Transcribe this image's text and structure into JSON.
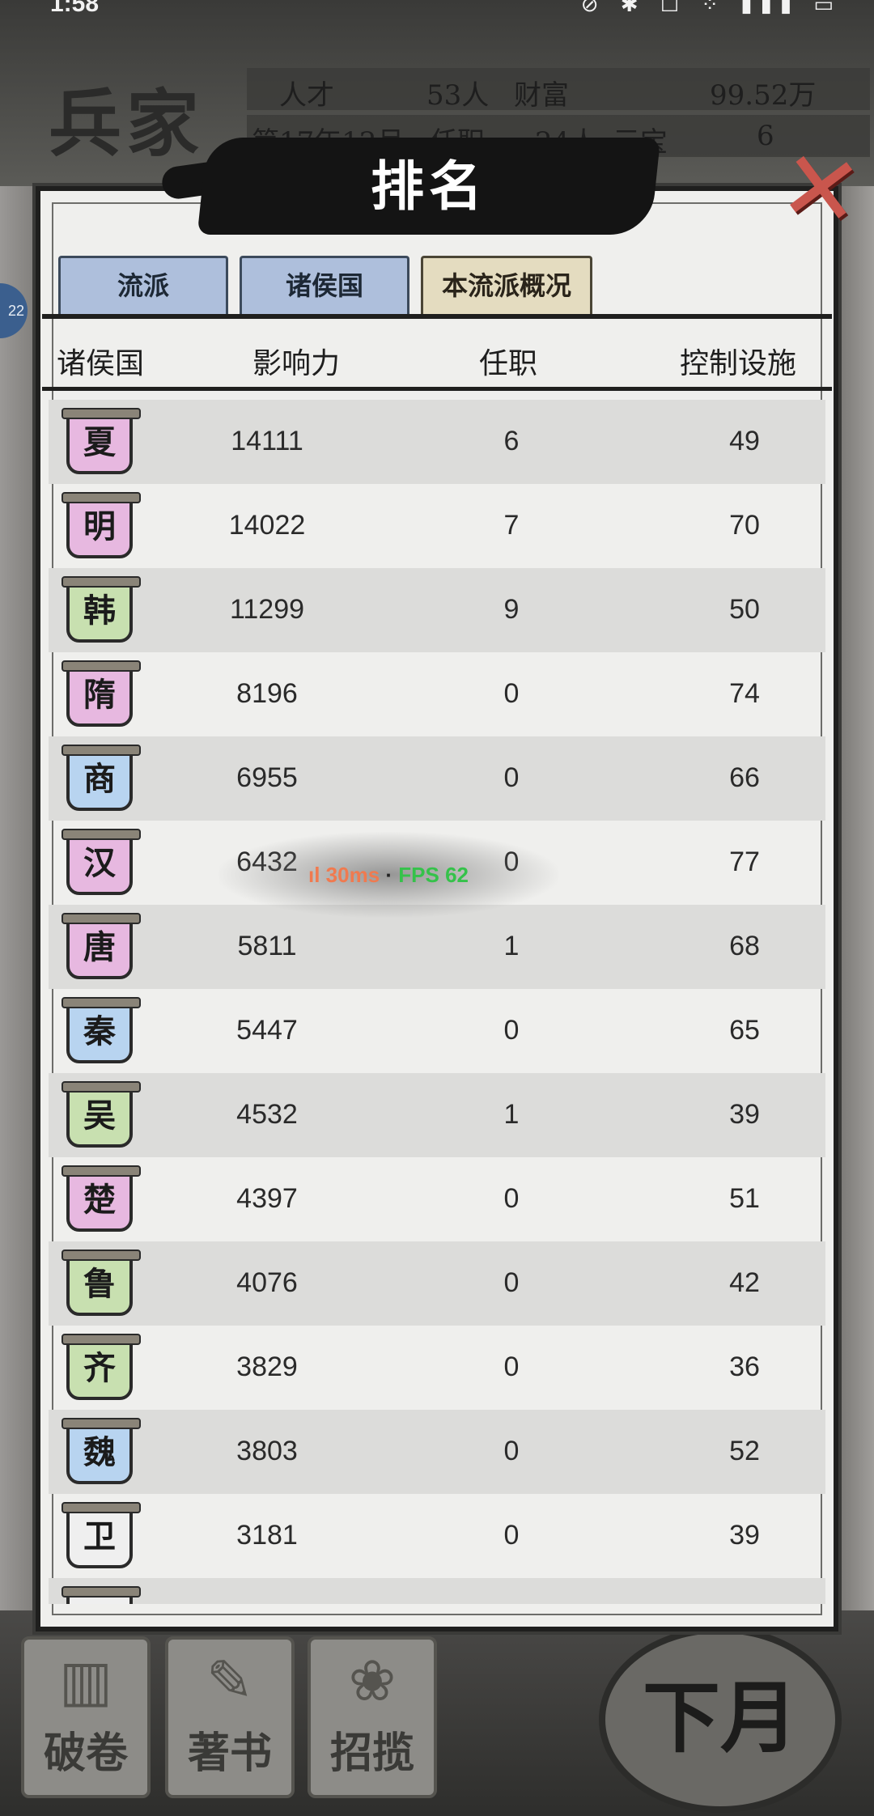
{
  "status_bar": {
    "time": "1:58",
    "icons": "⊘ ✱ ☐ ⁘ ▮▮▮ ▭"
  },
  "background": {
    "school_name": "兵家",
    "stats_row1": {
      "talent_label": "人才",
      "talent_value": "53人",
      "wealth_label": "财富",
      "wealth_value": "99.52万"
    },
    "stats_row2": {
      "date": "第17年12月",
      "office_label": "任职",
      "office_value": "24人",
      "ingot_label": "元宝",
      "ingot_value": "6"
    },
    "side_badge": "22",
    "bottom_buttons": [
      "破卷",
      "著书",
      "招揽"
    ],
    "next_month": "下月"
  },
  "dialog": {
    "title": "排名",
    "close_icon": "close-icon",
    "tabs": [
      {
        "label": "流派",
        "active": false
      },
      {
        "label": "诸侯国",
        "active": false
      },
      {
        "label": "本流派概况",
        "active": true
      }
    ],
    "columns": {
      "state": "诸侯国",
      "influence": "影响力",
      "office": "任职",
      "facilities": "控制设施"
    },
    "rows": [
      {
        "state": "夏",
        "color": "#e7b8e0",
        "influence": "14111",
        "office": "6",
        "facilities": "49"
      },
      {
        "state": "明",
        "color": "#e7b8e0",
        "influence": "14022",
        "office": "7",
        "facilities": "70"
      },
      {
        "state": "韩",
        "color": "#c8e0b0",
        "influence": "11299",
        "office": "9",
        "facilities": "50"
      },
      {
        "state": "隋",
        "color": "#e7b8e0",
        "influence": "8196",
        "office": "0",
        "facilities": "74"
      },
      {
        "state": "商",
        "color": "#b8d4f0",
        "influence": "6955",
        "office": "0",
        "facilities": "66"
      },
      {
        "state": "汉",
        "color": "#e7b8e0",
        "influence": "6432",
        "office": "0",
        "facilities": "77"
      },
      {
        "state": "唐",
        "color": "#e7b8e0",
        "influence": "5811",
        "office": "1",
        "facilities": "68"
      },
      {
        "state": "秦",
        "color": "#b8d4f0",
        "influence": "5447",
        "office": "0",
        "facilities": "65"
      },
      {
        "state": "吴",
        "color": "#c8e0b0",
        "influence": "4532",
        "office": "1",
        "facilities": "39"
      },
      {
        "state": "楚",
        "color": "#e7b8e0",
        "influence": "4397",
        "office": "0",
        "facilities": "51"
      },
      {
        "state": "鲁",
        "color": "#c8e0b0",
        "influence": "4076",
        "office": "0",
        "facilities": "42"
      },
      {
        "state": "齐",
        "color": "#c8e0b0",
        "influence": "3829",
        "office": "0",
        "facilities": "36"
      },
      {
        "state": "魏",
        "color": "#b8d4f0",
        "influence": "3803",
        "office": "0",
        "facilities": "52"
      },
      {
        "state": "卫",
        "color": "#efefef",
        "influence": "3181",
        "office": "0",
        "facilities": "39"
      },
      {
        "state": "",
        "color": "#efefef",
        "influence": "",
        "office": "",
        "facilities": ""
      }
    ]
  },
  "fps_overlay": {
    "latency": "ıl 30ms",
    "separator": " · ",
    "fps": "FPS 62"
  }
}
